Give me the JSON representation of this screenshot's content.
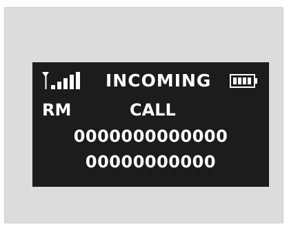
{
  "screen": {
    "status": {
      "title": "INCOMING",
      "signal_icon": "signal-strength-icon",
      "battery_icon": "battery-full-icon"
    },
    "line2": {
      "mode": "RM",
      "label": "CALL"
    },
    "numbers": [
      "0000000000000",
      "00000000000"
    ]
  }
}
